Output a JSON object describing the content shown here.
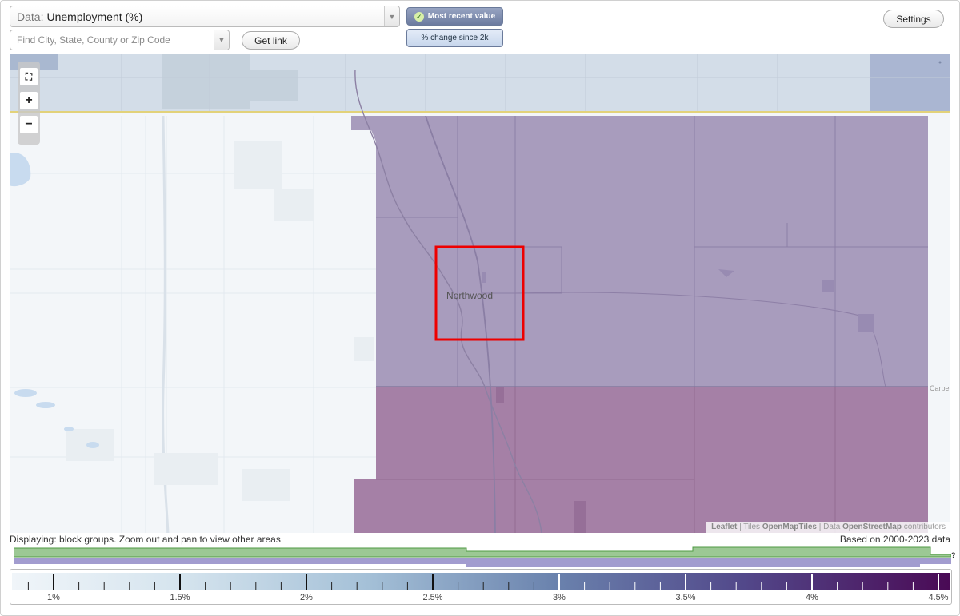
{
  "header": {
    "data_prefix": "Data:",
    "data_value": "Unemployment (%)",
    "search_placeholder": "Find City, State, County or Zip Code",
    "get_link_label": "Get link",
    "settings_label": "Settings",
    "mode_recent_label": "Most recent value",
    "mode_change_label": "% change since 2k"
  },
  "map": {
    "place_label": "Northwood",
    "edge_label": "Carpe",
    "attribution": {
      "leaflet": "Leaflet",
      "tiles_prefix": "Tiles",
      "tiles": "OpenMapTiles",
      "data_prefix": "Data",
      "data": "OpenStreetMap",
      "data_suffix": "contributors"
    },
    "colors": {
      "upper_region": "#a89cbd",
      "lower_region": "#a580a6",
      "top_band": "#d3dde8",
      "highlight": "#ee0000"
    }
  },
  "footer": {
    "displaying": "Displaying: block groups. Zoom out and pan to view other areas",
    "based_on": "Based on 2000-2023 data",
    "timeline_q": "?"
  },
  "legend": {
    "ticks": [
      "1%",
      "1.5%",
      "2%",
      "2.5%",
      "3%",
      "3.5%",
      "4%",
      "4.5%"
    ],
    "color_start": "#f0f5f9",
    "color_mid": "#6a82ad",
    "color_end": "#4a0a55"
  }
}
